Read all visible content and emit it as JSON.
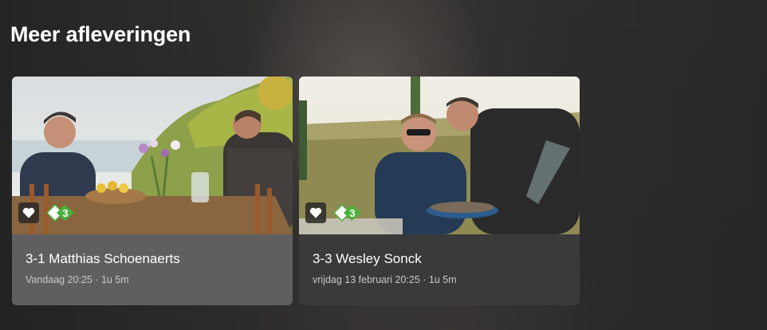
{
  "section": {
    "title": "Meer afleveringen"
  },
  "episodes": [
    {
      "title": "3-1 Matthias Schoenaerts",
      "meta": "Vandaag 20:25 · 1u 5m",
      "channel": "npo3-logo"
    },
    {
      "title": "3-3 Wesley Sonck",
      "meta": "vrijdag 13 februari 20:25 · 1u 5m",
      "channel": "npo3-logo"
    }
  ],
  "colors": {
    "npo3_green": "#49b23c",
    "card_active": "#5f5f5f",
    "card": "#3a3a3a"
  }
}
